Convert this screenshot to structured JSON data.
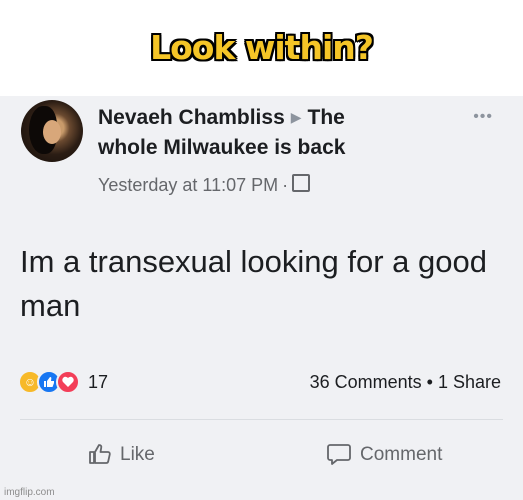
{
  "meme": {
    "caption": "Look within?"
  },
  "post": {
    "author": "Nevaeh Chambliss",
    "group_line1": "The",
    "group_line2": "whole Milwaukee is back",
    "timestamp": "Yesterday at 11:07 PM",
    "meta_separator": "·",
    "more_label": "•••",
    "text": "Im a transexual looking for a good man",
    "reaction_count": "17",
    "comments": "36 Comments",
    "stats_separator": "•",
    "shares": "1 Share",
    "actions": {
      "like": "Like",
      "comment": "Comment"
    }
  },
  "watermark": "imgflip.com",
  "colors": {
    "caption": "#f5c527",
    "card_bg": "#f0f1f4",
    "haha": "#f7b928",
    "like": "#1877f2",
    "love": "#f33e58"
  },
  "icons": [
    "haha-reaction-icon",
    "like-reaction-icon",
    "love-reaction-icon",
    "thumbs-up-icon",
    "comment-bubble-icon",
    "globe-icon"
  ]
}
